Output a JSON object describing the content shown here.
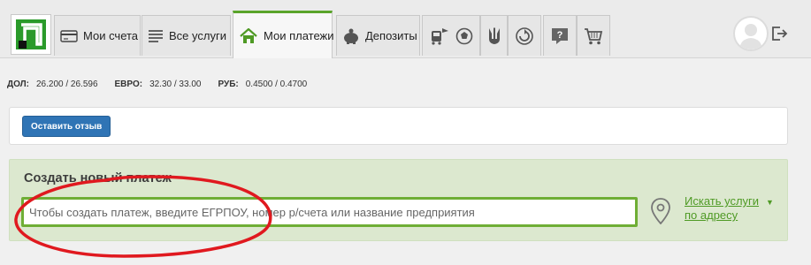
{
  "nav": {
    "tabs": [
      {
        "label": "Мои счета",
        "icon": "card-icon"
      },
      {
        "label": "Все услуги",
        "icon": "list-icon"
      },
      {
        "label": "Мои платежи",
        "icon": "home-icon",
        "active": true
      },
      {
        "label": "Депозиты",
        "icon": "piggy-bank-icon"
      }
    ],
    "icon_tabs": [
      "transport-icon",
      "football-icon",
      "trident-icon",
      "restart-icon",
      "help-icon",
      "cart-icon"
    ],
    "accent_color": "#5aa52b"
  },
  "rates": [
    {
      "label": "ДОЛ:",
      "value": "26.200 / 26.596"
    },
    {
      "label": "ЕВРО:",
      "value": "32.30 / 33.00"
    },
    {
      "label": "РУБ:",
      "value": "0.4500 / 0.4700"
    }
  ],
  "feedback": {
    "button_label": "Оставить отзыв",
    "button_color": "#2f74b5"
  },
  "create_payment": {
    "title": "Создать новый платеж",
    "search_placeholder": "Чтобы создать платеж, введите ЕГРПОУ, номер р/счета или название предприятия",
    "address_link_line1": "Искать услуги",
    "address_link_line2": "по адресу",
    "panel_color": "#dce8cf",
    "input_border_color": "#6fae35"
  },
  "annotation_color": "#e0191f"
}
